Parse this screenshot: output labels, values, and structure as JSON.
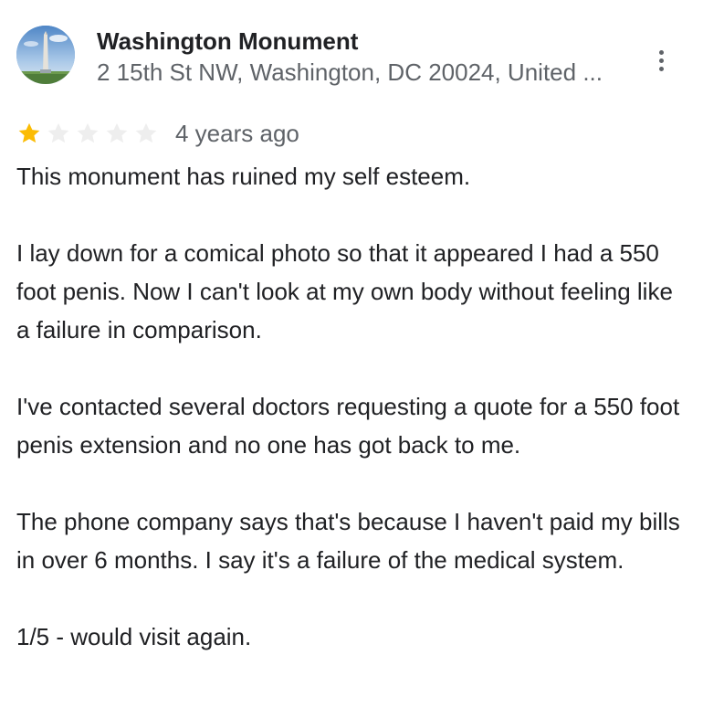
{
  "place": {
    "name": "Washington Monument",
    "address": "2 15th St NW, Washington, DC 20024, United ..."
  },
  "review": {
    "rating": 1,
    "rating_max": 5,
    "star_filled_color": "#fbbc04",
    "star_empty_color": "#eeeeee",
    "date": "4 years ago",
    "paragraphs": [
      "This monument has ruined my self esteem.",
      "I lay down for a comical photo so that it appeared I had a 550 foot penis. Now I can't look at my own body without feeling like a failure in comparison.",
      "I've contacted several doctors requesting a quote for a 550 foot penis extension and no one has got back to me.",
      "The phone company says that's because I haven't paid my bills in over 6 months. I say it's a failure of the medical system.",
      "1/5 - would visit again."
    ]
  },
  "icons": {
    "more": "more-vert-icon",
    "star": "star-icon"
  }
}
